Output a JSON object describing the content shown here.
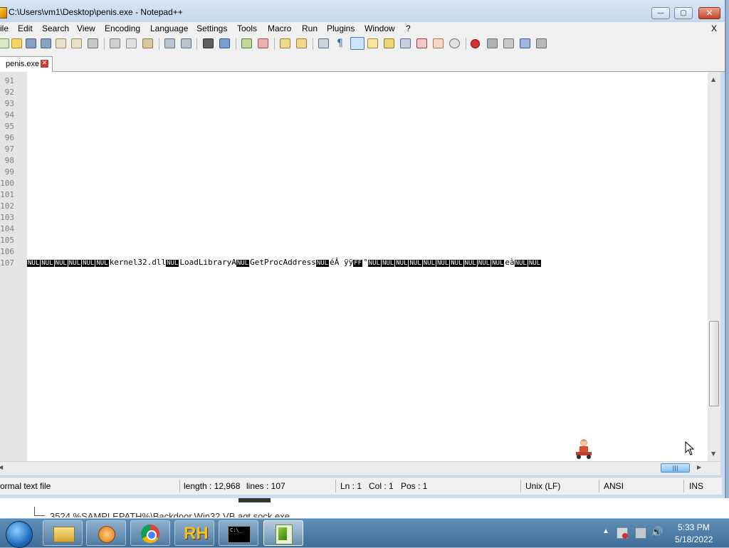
{
  "window": {
    "title": "C:\\Users\\vm1\\Desktop\\penis.exe - Notepad++",
    "controls": {
      "minimize": "—",
      "maximize": "▢",
      "close": "✕"
    }
  },
  "menubar": {
    "items": [
      "ile",
      "Edit",
      "Search",
      "View",
      "Encoding",
      "Language",
      "Settings",
      "Tools",
      "Macro",
      "Run",
      "Plugins",
      "Window",
      "?"
    ],
    "close": "X"
  },
  "toolbar": {
    "icons": [
      "new-file-icon",
      "open-file-icon",
      "save-icon",
      "save-all-icon",
      "close-icon",
      "close-all-icon",
      "print-icon",
      "cut-icon",
      "copy-icon",
      "paste-icon",
      "undo-icon",
      "redo-icon",
      "find-icon",
      "replace-icon",
      "zoom-in-icon",
      "zoom-out-icon",
      "sync-vertical-icon",
      "sync-horizontal-icon",
      "word-wrap-icon",
      "show-all-chars-icon",
      "indent-guide-icon",
      "doc-map-icon",
      "function-list-icon",
      "folder-workspace-icon",
      "doc-list-icon",
      "record-macro-icon",
      "stop-record-icon",
      "play-macro-icon",
      "run-macro-multiple-icon",
      "save-macro-icon"
    ]
  },
  "tab": {
    "label": "penis.exe",
    "close": "✕"
  },
  "editor": {
    "line_numbers": [
      "91",
      "92",
      "93",
      "94",
      "95",
      "96",
      "97",
      "98",
      "99",
      "100",
      "101",
      "102",
      "103",
      "104",
      "105",
      "106",
      "107"
    ],
    "line_107_segments": [
      {
        "t": "NUL",
        "c": true
      },
      {
        "t": "NUL",
        "c": true
      },
      {
        "t": "NUL",
        "c": true
      },
      {
        "t": "NUL",
        "c": true
      },
      {
        "t": "NUL",
        "c": true
      },
      {
        "t": "NUL",
        "c": true
      },
      {
        "t": "kernel32.dll",
        "c": false
      },
      {
        "t": "NUL",
        "c": true
      },
      {
        "t": "LoadLibraryA",
        "c": false
      },
      {
        "t": "NUL",
        "c": true
      },
      {
        "t": "GetProcAddress",
        "c": false
      },
      {
        "t": "NUL",
        "c": true
      },
      {
        "t": "éÂ ÿÿ",
        "c": false
      },
      {
        "t": "FF",
        "c": true
      },
      {
        "t": "°",
        "c": false
      },
      {
        "t": "NUL",
        "c": true
      },
      {
        "t": "NUL",
        "c": true
      },
      {
        "t": "NUL",
        "c": true
      },
      {
        "t": "NUL",
        "c": true
      },
      {
        "t": "NUL",
        "c": true
      },
      {
        "t": "NUL",
        "c": true
      },
      {
        "t": "NUL",
        "c": true
      },
      {
        "t": "NUL",
        "c": true
      },
      {
        "t": "NUL",
        "c": true
      },
      {
        "t": "NUL",
        "c": true
      },
      {
        "t": "eà",
        "c": false
      },
      {
        "t": "NUL",
        "c": true
      },
      {
        "t": "NUL",
        "c": true
      }
    ]
  },
  "statusbar": {
    "file_type": "ormal text file",
    "length": "length : 12,968",
    "lines": "lines : 107",
    "ln": "Ln : 1",
    "col": "Col : 1",
    "pos": "Pos : 1",
    "eol": "Unix (LF)",
    "encoding": "ANSI",
    "mode": "INS"
  },
  "background_window": {
    "text": "3524   %SAMPLEPATH%\\Backdoor.Win32.VB.agt.sock.exe"
  },
  "taskbar": {
    "apps": [
      "explorer-icon",
      "media-player-icon",
      "chrome-icon",
      "reshacker-icon",
      "cmd-icon",
      "notepadpp-icon"
    ],
    "reshacker_label": "RH",
    "cmd_label": "C:\\_",
    "time": "5:33 PM",
    "date": "5/18/2022"
  }
}
